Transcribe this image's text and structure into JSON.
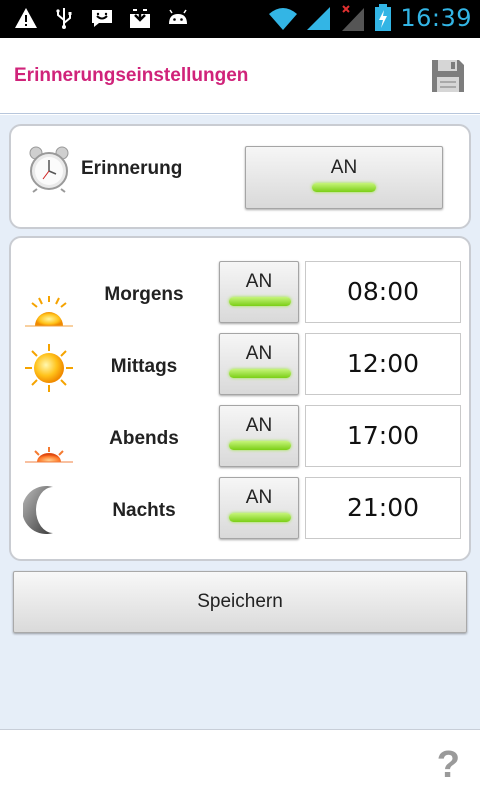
{
  "status_bar": {
    "time": "16:39",
    "icons": [
      "warning-icon",
      "usb-icon",
      "chat-icon",
      "download-icon",
      "android-icon",
      "wifi-icon",
      "signal-icon",
      "signal-no-service-icon",
      "battery-charging-icon"
    ]
  },
  "header": {
    "title": "Erinnerungseinstellungen",
    "save_icon": "save-icon",
    "title_color": "#d0237a"
  },
  "reminder": {
    "label": "Erinnerung",
    "toggle_label": "AN",
    "icon": "alarm-clock-icon"
  },
  "times": [
    {
      "label": "Morgens",
      "toggle_label": "AN",
      "time": "08:00",
      "icon": "sunrise-icon"
    },
    {
      "label": "Mittags",
      "toggle_label": "AN",
      "time": "12:00",
      "icon": "sun-icon"
    },
    {
      "label": "Abends",
      "toggle_label": "AN",
      "time": "17:00",
      "icon": "sunset-icon"
    },
    {
      "label": "Nachts",
      "toggle_label": "AN",
      "time": "21:00",
      "icon": "moon-icon"
    }
  ],
  "save_button_label": "Speichern",
  "footer": {
    "help_label": "?"
  },
  "colors": {
    "accent": "#d0237a",
    "toggle_on": "#7bcf16",
    "status_time": "#33b5e5",
    "content_bg": "#e6eef8"
  }
}
